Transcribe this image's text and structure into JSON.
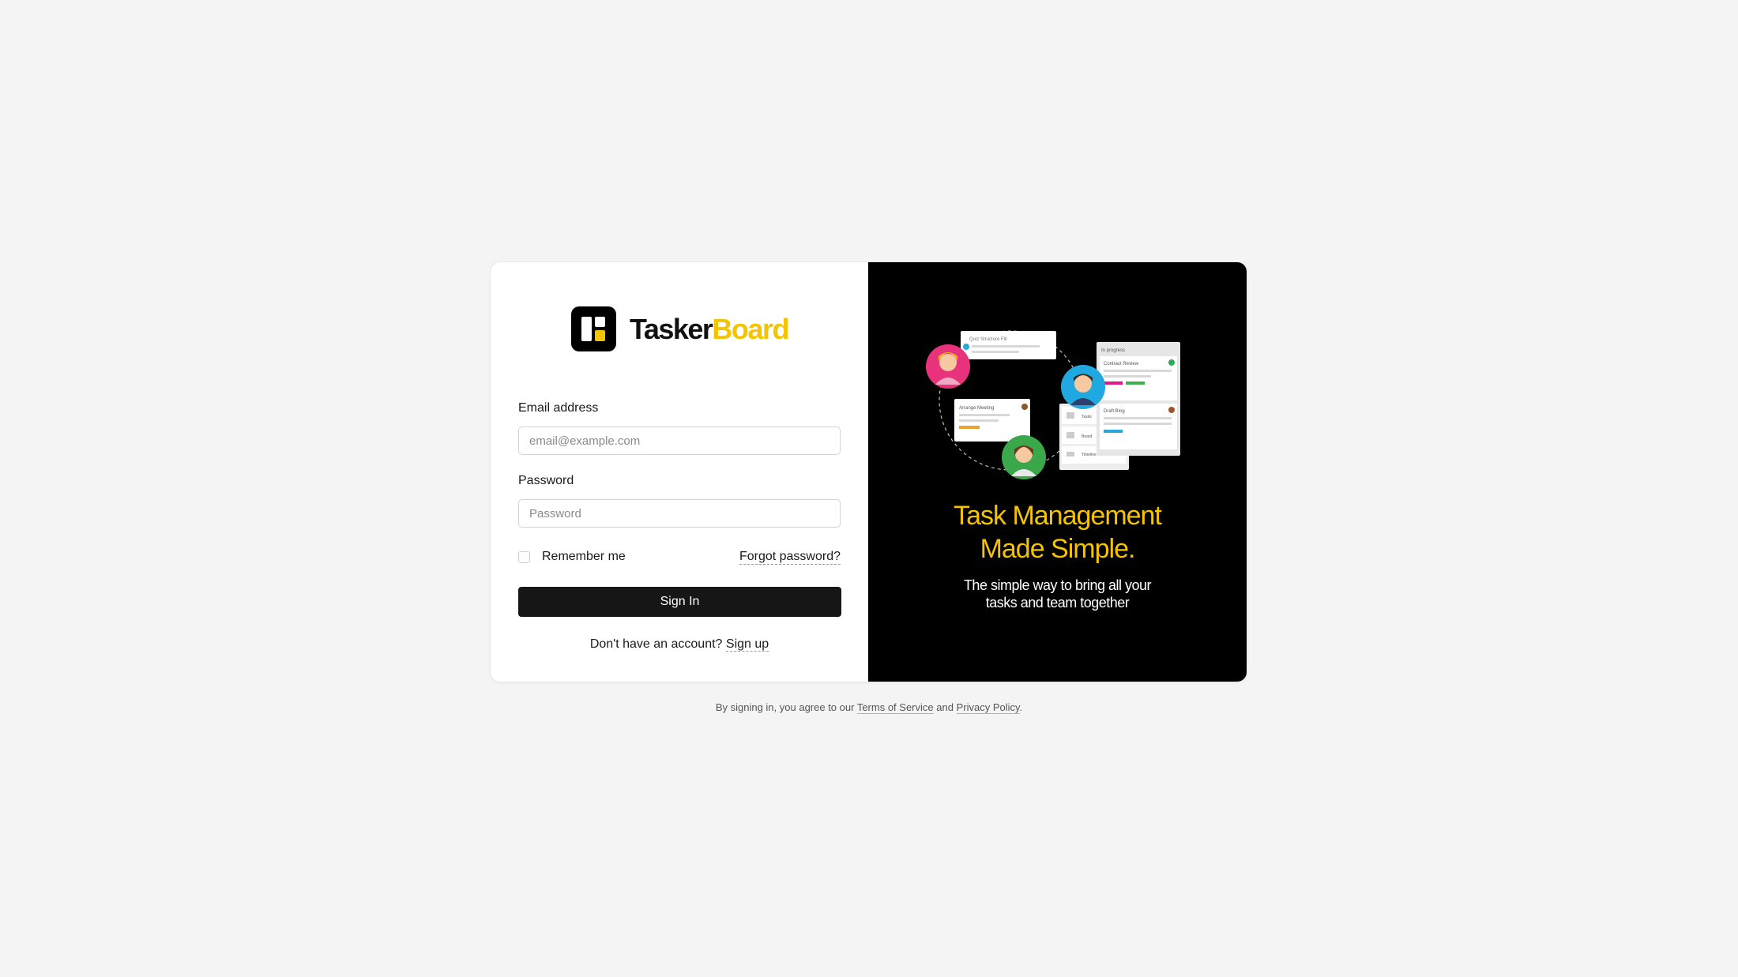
{
  "brand": {
    "name_part1": "Tasker",
    "name_part2": "Board",
    "accent": "#f5c400",
    "mark_icon": "board-logo-icon"
  },
  "form": {
    "email_label": "Email address",
    "email_placeholder": "email@example.com",
    "password_label": "Password",
    "password_placeholder": "Password",
    "remember_label": "Remember me",
    "forgot_link": "Forgot password?",
    "signin_button": "Sign In",
    "signup_prompt": "Don't have an account?",
    "signup_link": "Sign up"
  },
  "promo": {
    "headline_line1": "Task Management",
    "headline_line2": "Made Simple.",
    "subline_line1": "The simple way to bring all your",
    "subline_line2": "tasks and team together",
    "illustration": {
      "card_title_1": "Quiz Structure Fill",
      "card_title_2": "Arrange Meeting",
      "column_title": "In progress",
      "column_card_1": "Contract Review",
      "column_card_2": "Draft Blog",
      "nav_items": [
        "Tasks",
        "Board",
        "Timeline"
      ]
    }
  },
  "footer": {
    "prefix": "By signing in, you agree to our",
    "terms_link": "Terms of Service",
    "and": "and",
    "privacy_link": "Privacy Policy",
    "suffix": "."
  }
}
